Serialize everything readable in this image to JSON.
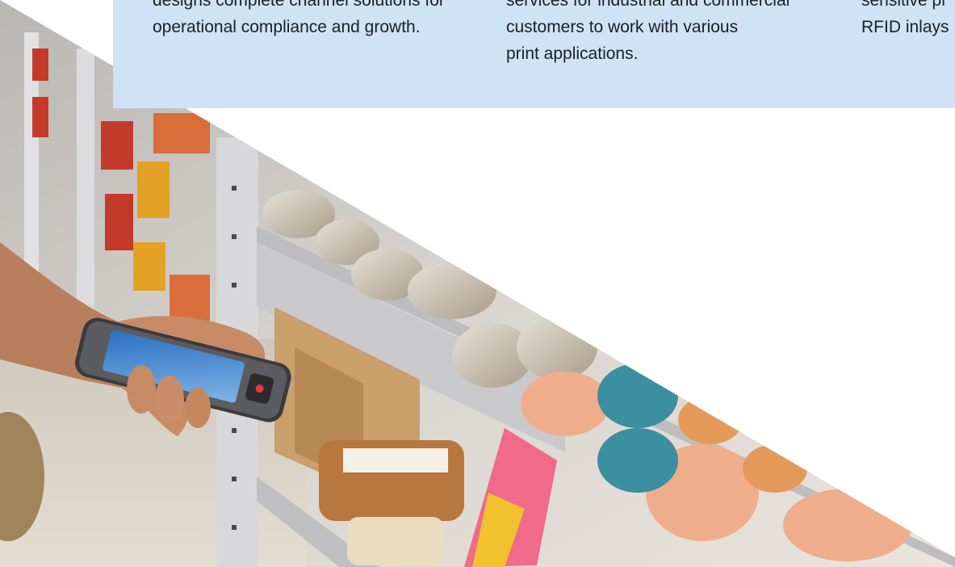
{
  "columns": [
    {
      "text": "designs complete channel solutions for\noperational compliance and growth."
    },
    {
      "text": "services for industrial and commercial\ncustomers to work with various\nprint applications."
    },
    {
      "text": "sensitive pr\nRFID inlays"
    }
  ],
  "photo": {
    "description_icon": "handheld-scanner-retail-shelf-photo"
  }
}
